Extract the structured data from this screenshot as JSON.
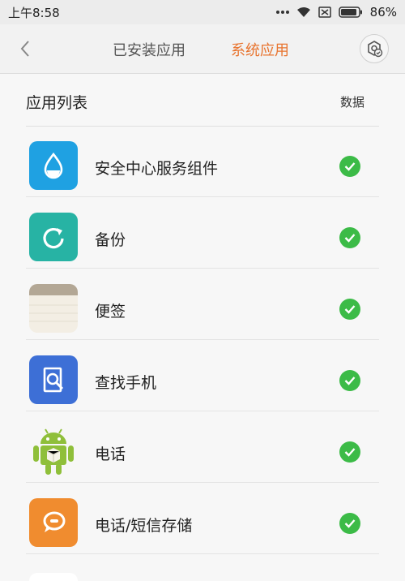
{
  "status_bar": {
    "time": "上午8:58",
    "battery_percent": "86%",
    "icons": [
      "more-dots-icon",
      "wifi-icon",
      "sim-none-icon",
      "battery-icon"
    ]
  },
  "header": {
    "tabs": [
      {
        "label": "已安装应用",
        "active": false
      },
      {
        "label": "系统应用",
        "active": true
      }
    ],
    "accent_color": "#e8742f"
  },
  "list_header": {
    "title": "应用列表",
    "data_label": "数据"
  },
  "apps": [
    {
      "name": "安全中心服务组件",
      "icon": "security-center-icon",
      "icon_color": "#1fa1e2",
      "enabled": true
    },
    {
      "name": "备份",
      "icon": "backup-icon",
      "icon_color": "#27b3a4",
      "enabled": true
    },
    {
      "name": "便签",
      "icon": "notes-icon",
      "icon_color": "#f3eee4",
      "enabled": true
    },
    {
      "name": "查找手机",
      "icon": "find-phone-icon",
      "icon_color": "#3d6fd6",
      "enabled": true
    },
    {
      "name": "电话",
      "icon": "android-icon",
      "icon_color": "#8fbf3a",
      "enabled": true
    },
    {
      "name": "电话/短信存储",
      "icon": "phone-sms-storage-icon",
      "icon_color": "#f08c2f",
      "enabled": true
    }
  ],
  "check_color": "#3cbb47"
}
